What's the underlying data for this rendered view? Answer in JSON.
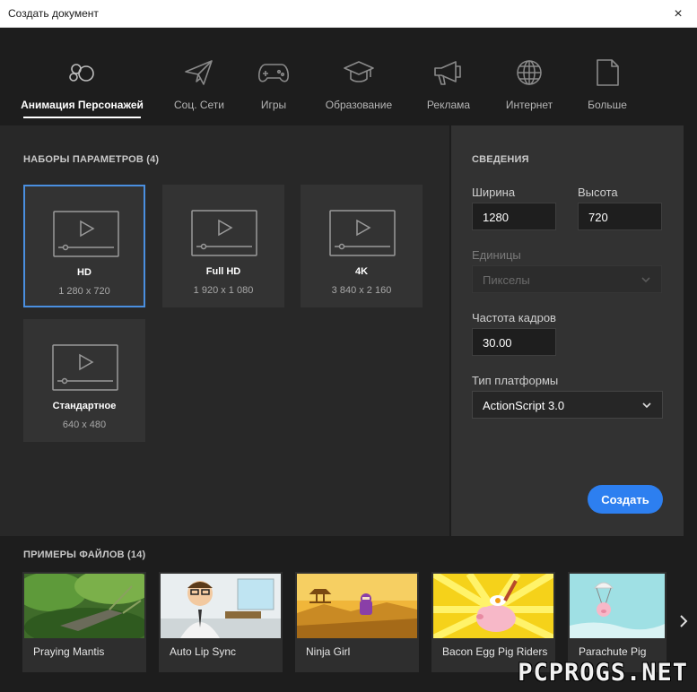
{
  "window": {
    "title": "Создать документ",
    "close_icon": "×"
  },
  "tabs": [
    {
      "label": "Анимация Персонажей",
      "icon": "character-animation-icon",
      "active": true
    },
    {
      "label": "Соц. Сети",
      "icon": "paper-plane-icon",
      "active": false
    },
    {
      "label": "Игры",
      "icon": "gamepad-icon",
      "active": false
    },
    {
      "label": "Образование",
      "icon": "graduation-cap-icon",
      "active": false
    },
    {
      "label": "Реклама",
      "icon": "megaphone-icon",
      "active": false
    },
    {
      "label": "Интернет",
      "icon": "globe-icon",
      "active": false
    },
    {
      "label": "Больше",
      "icon": "document-icon",
      "active": false
    }
  ],
  "presets": {
    "title": "НАБОРЫ ПАРАМЕТРОВ (4)",
    "items": [
      {
        "name": "HD",
        "size": "1 280 x 720",
        "selected": true
      },
      {
        "name": "Full HD",
        "size": "1 920 x 1 080",
        "selected": false
      },
      {
        "name": "4K",
        "size": "3 840 x 2 160",
        "selected": false
      },
      {
        "name": "Стандартное",
        "size": "640 x 480",
        "selected": false
      }
    ]
  },
  "details": {
    "title": "СВЕДЕНИЯ",
    "width_label": "Ширина",
    "width_value": "1280",
    "height_label": "Высота",
    "height_value": "720",
    "units_label": "Единицы",
    "units_value": "Пикселы",
    "fps_label": "Частота кадров",
    "fps_value": "30.00",
    "platform_label": "Тип платформы",
    "platform_value": "ActionScript 3.0",
    "create_button": "Создать"
  },
  "samples": {
    "title": "ПРИМЕРЫ ФАЙЛОВ (14)",
    "items": [
      {
        "name": "Praying Mantis"
      },
      {
        "name": "Auto Lip Sync"
      },
      {
        "name": "Ninja Girl"
      },
      {
        "name": "Bacon Egg Pig Riders"
      },
      {
        "name": "Parachute Pig"
      }
    ]
  },
  "watermark": "PCPROGS.NET",
  "colors": {
    "accent": "#2d7ff0",
    "selection": "#4a8fe0",
    "panel": "#282828",
    "details_panel": "#323232",
    "background": "#1d1d1d"
  }
}
